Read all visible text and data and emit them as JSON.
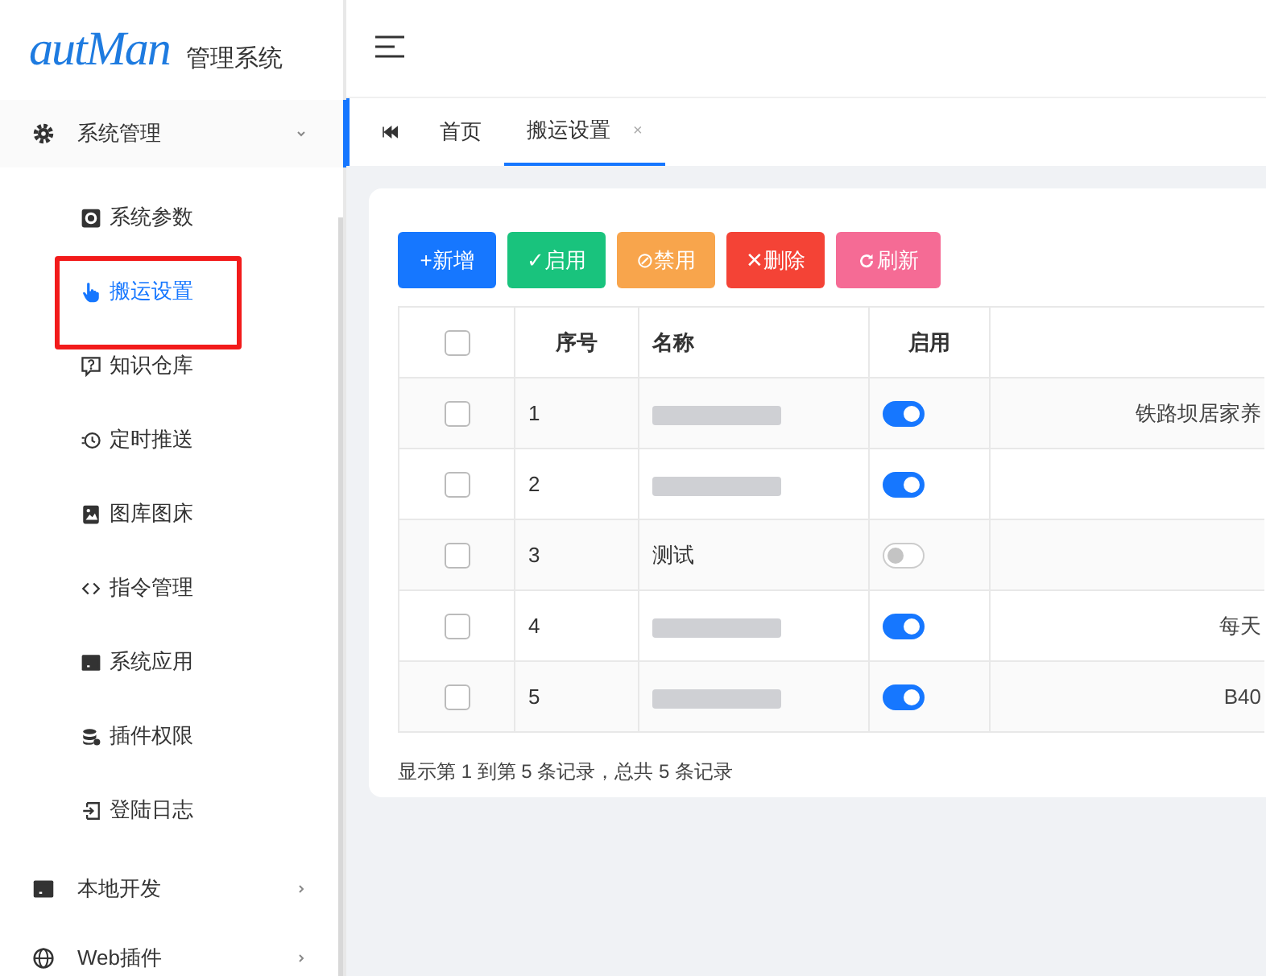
{
  "logo": {
    "brand": "autMan",
    "title": "管理系统"
  },
  "sidebar": {
    "items": [
      {
        "label": "系统管理",
        "expanded": true,
        "children": [
          {
            "label": "系统参数",
            "selected": false,
            "highlighted": false
          },
          {
            "label": "搬运设置",
            "selected": true,
            "highlighted": true
          },
          {
            "label": "知识仓库",
            "selected": false,
            "highlighted": false
          },
          {
            "label": "定时推送",
            "selected": false,
            "highlighted": false
          },
          {
            "label": "图库图床",
            "selected": false,
            "highlighted": false
          },
          {
            "label": "指令管理",
            "selected": false,
            "highlighted": false
          },
          {
            "label": "系统应用",
            "selected": false,
            "highlighted": false
          },
          {
            "label": "插件权限",
            "selected": false,
            "highlighted": false
          },
          {
            "label": "登陆日志",
            "selected": false,
            "highlighted": false
          }
        ]
      },
      {
        "label": "本地开发",
        "expanded": false
      },
      {
        "label": "Web插件",
        "expanded": false
      }
    ]
  },
  "tabs": [
    {
      "label": "首页",
      "selected": false,
      "closable": false
    },
    {
      "label": "搬运设置",
      "selected": true,
      "closable": true,
      "close": "×"
    }
  ],
  "toolbar": {
    "buttons": [
      {
        "kind": "add",
        "label": "+新增"
      },
      {
        "kind": "enable",
        "label": "✓启用"
      },
      {
        "kind": "disable",
        "label": "⊘禁用"
      },
      {
        "kind": "delete",
        "label": "✕删除"
      },
      {
        "kind": "refresh",
        "label": "刷新"
      }
    ]
  },
  "table": {
    "select_all": {
      "checked": false
    },
    "columns": [
      "序号",
      "名称",
      "启用"
    ],
    "rows": [
      {
        "checked": false,
        "index": "1",
        "name_redacted": true,
        "enabled": true,
        "column_5": "铁路坝居家养"
      },
      {
        "checked": false,
        "index": "2",
        "name_redacted": true,
        "enabled": true
      },
      {
        "checked": false,
        "index": "3",
        "name": "测试",
        "name_redacted": false,
        "enabled": false
      },
      {
        "checked": false,
        "index": "4",
        "name_redacted": true,
        "enabled": true,
        "column_5": "每天"
      },
      {
        "checked": false,
        "index": "5",
        "name_redacted": true,
        "enabled": true,
        "column_5": "B40"
      }
    ]
  },
  "pagination_info": "显示第 1 到第 5 条记录，总共 5 条记录"
}
